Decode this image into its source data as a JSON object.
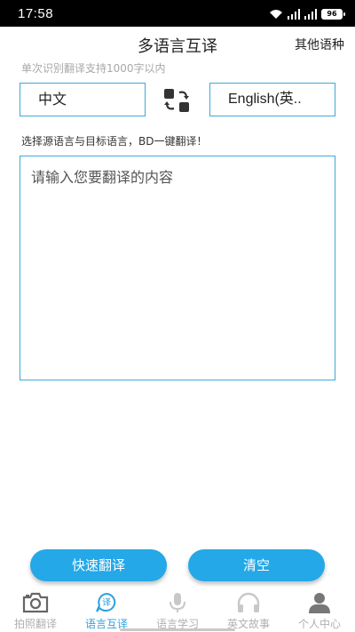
{
  "status": {
    "time": "17:58",
    "battery": "96"
  },
  "header": {
    "title": "多语言互译",
    "other_languages": "其他语种"
  },
  "hint_top": "单次识别翻译支持1000字以内",
  "languages": {
    "source": "中文",
    "target": "English(英.."
  },
  "hint_mid": "选择源语言与目标语言，BD一键翻译！",
  "input": {
    "placeholder": "请输入您要翻译的内容",
    "value": ""
  },
  "buttons": {
    "translate": "快速翻译",
    "clear": "清空"
  },
  "tabs": [
    {
      "label": "拍照翻译",
      "icon": "camera-icon"
    },
    {
      "label": "语言互译",
      "icon": "translate-icon",
      "active": true
    },
    {
      "label": "语言学习",
      "icon": "microphone-icon"
    },
    {
      "label": "英文故事",
      "icon": "headphones-icon"
    },
    {
      "label": "个人中心",
      "icon": "user-icon"
    }
  ],
  "colors": {
    "accent": "#24a8e8",
    "border": "#3ea8d8",
    "inactive": "#b0b0b0"
  }
}
